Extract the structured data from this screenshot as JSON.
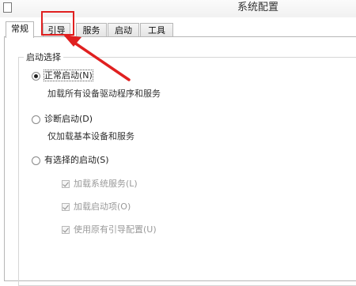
{
  "window": {
    "title": "系统配置"
  },
  "tabs": [
    {
      "label": "常规",
      "active": true
    },
    {
      "label": "引导",
      "active": false
    },
    {
      "label": "服务",
      "active": false
    },
    {
      "label": "启动",
      "active": false
    },
    {
      "label": "工具",
      "active": false
    }
  ],
  "startup_selection": {
    "legend": "启动选择",
    "normal": {
      "label": "正常启动(N)",
      "description": "加载所有设备驱动程序和服务",
      "selected": true
    },
    "diagnostic": {
      "label": "诊断启动(D)",
      "description": "仅加载基本设备和服务",
      "selected": false
    },
    "selective": {
      "label": "有选择的启动(S)",
      "selected": false,
      "options": [
        {
          "label": "加载系统服务(L)",
          "checked": true,
          "enabled": false
        },
        {
          "label": "加载启动项(O)",
          "checked": true,
          "enabled": false
        },
        {
          "label": "使用原有引导配置(U)",
          "checked": true,
          "enabled": false
        }
      ]
    }
  },
  "annotation": {
    "color": "#e02020",
    "target": "tab-boot"
  }
}
